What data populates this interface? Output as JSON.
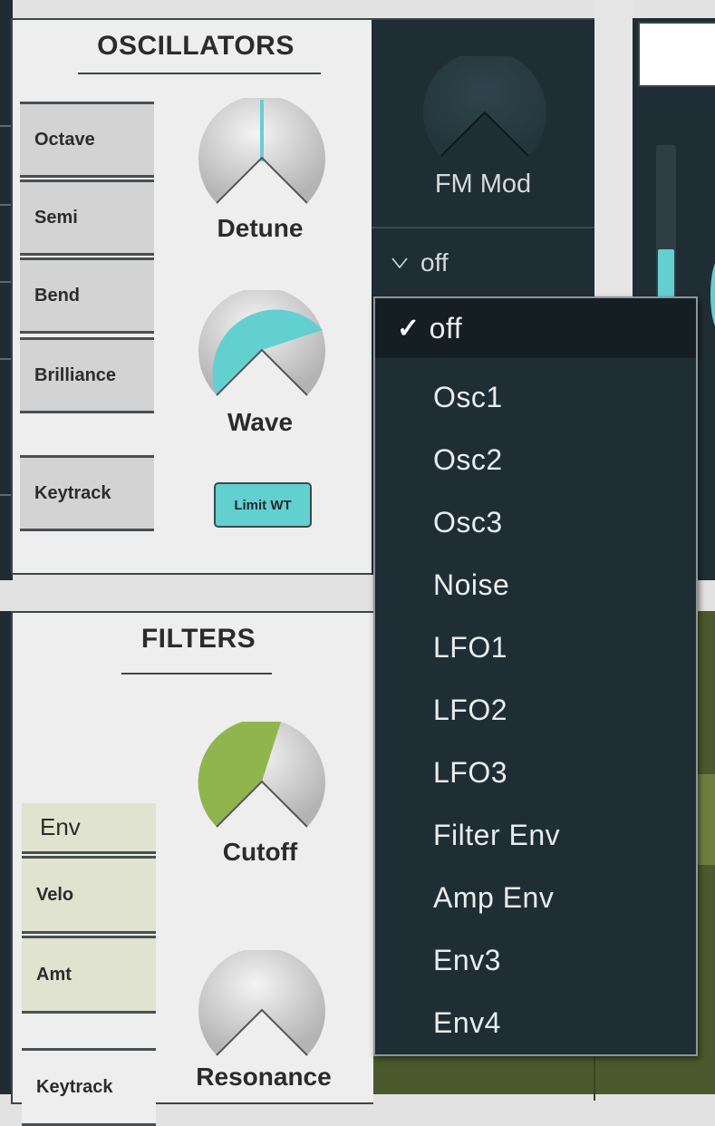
{
  "oscillators": {
    "title": "OSCILLATORS",
    "params": [
      "Octave",
      "Semi",
      "Bend",
      "Brilliance",
      "Keytrack"
    ],
    "detune_label": "Detune",
    "wave_label": "Wave",
    "limit_button": "Limit WT",
    "detune_level": 0.5,
    "wave_level": 0.6
  },
  "fm": {
    "label": "FM Mod",
    "source_value": "off"
  },
  "filters": {
    "title": "FILTERS",
    "env_label": "Env",
    "params": [
      "Velo",
      "Amt",
      "Keytrack"
    ],
    "cutoff_label": "Cutoff",
    "resonance_label": "Resonance",
    "cutoff_level": 0.55
  },
  "dropdown": {
    "selected": "off",
    "check_glyph": "✓",
    "options": [
      "off",
      "Osc1",
      "Osc2",
      "Osc3",
      "Noise",
      "LFO1",
      "LFO2",
      "LFO3",
      "Filter Env",
      "Amp Env",
      "Env3",
      "Env4"
    ]
  },
  "colors": {
    "accent_cyan": "#63d0d0",
    "accent_green": "#8fb64d",
    "panel_dark": "#1f2e34",
    "panel_light": "#eeeeee"
  }
}
